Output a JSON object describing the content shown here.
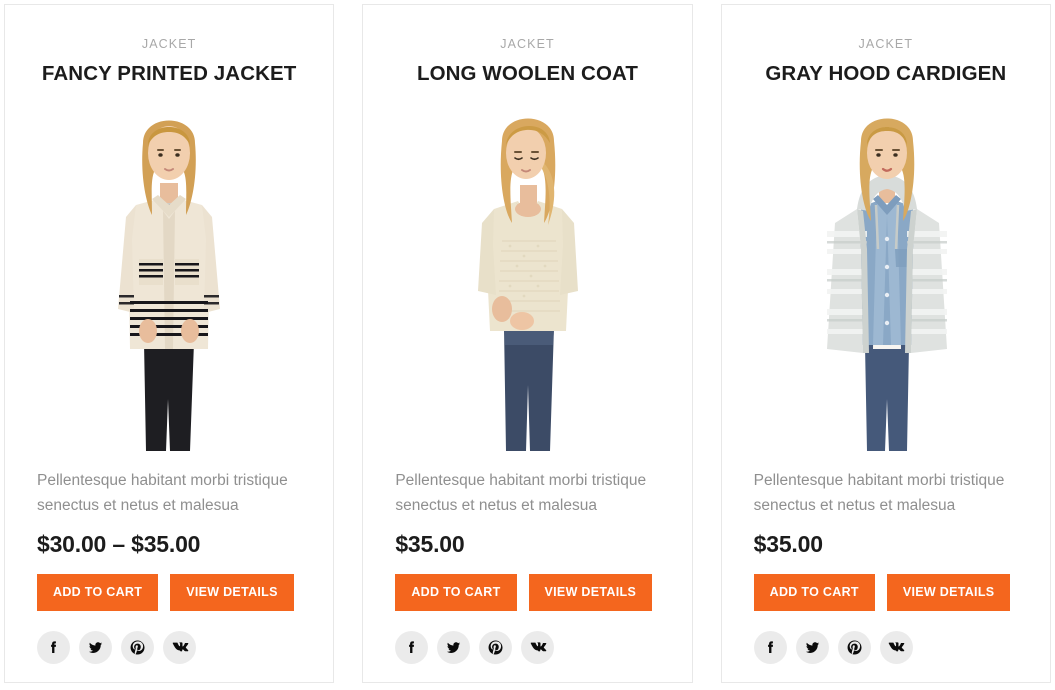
{
  "page": {
    "background": "#ffffff",
    "accent_color": "#f4661e",
    "card_border_color": "#e8e8e8",
    "social_bubble_color": "#ebebeb",
    "muted_text_color": "#8f8f8f",
    "category_text_color": "#a8a8a8",
    "title_text_color": "#1c1c1c"
  },
  "products": [
    {
      "category": "JACKET",
      "title": "FANCY PRINTED JACKET",
      "description": "Pellentesque habitant morbi tristique senectus et netus et malesua",
      "price": "$30.00 – $35.00",
      "add_to_cart_label": "ADD TO CART",
      "view_details_label": "VIEW DETAILS",
      "image_alt": "Woman wearing cream printed jacket with black striped pockets and black pants",
      "social": [
        {
          "name": "facebook",
          "icon": "facebook-icon"
        },
        {
          "name": "twitter",
          "icon": "twitter-icon"
        },
        {
          "name": "pinterest",
          "icon": "pinterest-icon"
        },
        {
          "name": "vk",
          "icon": "vk-icon"
        }
      ]
    },
    {
      "category": "JACKET",
      "title": "LONG WOOLEN COAT",
      "description": "Pellentesque habitant morbi tristique senectus et netus et malesua",
      "price": "$35.00",
      "add_to_cart_label": "ADD TO CART",
      "view_details_label": "VIEW DETAILS",
      "image_alt": "Woman wearing cream knit long woolen top with blue jeans",
      "social": [
        {
          "name": "facebook",
          "icon": "facebook-icon"
        },
        {
          "name": "twitter",
          "icon": "twitter-icon"
        },
        {
          "name": "pinterest",
          "icon": "pinterest-icon"
        },
        {
          "name": "vk",
          "icon": "vk-icon"
        }
      ]
    },
    {
      "category": "JACKET",
      "title": "GRAY HOOD CARDIGEN",
      "description": "Pellentesque habitant morbi tristique senectus et netus et malesua",
      "price": "$35.00",
      "add_to_cart_label": "ADD TO CART",
      "view_details_label": "VIEW DETAILS",
      "image_alt": "Woman wearing gray striped hooded cardigan over denim shirt with blue jeans",
      "social": [
        {
          "name": "facebook",
          "icon": "facebook-icon"
        },
        {
          "name": "twitter",
          "icon": "twitter-icon"
        },
        {
          "name": "pinterest",
          "icon": "pinterest-icon"
        },
        {
          "name": "vk",
          "icon": "vk-icon"
        }
      ]
    }
  ]
}
